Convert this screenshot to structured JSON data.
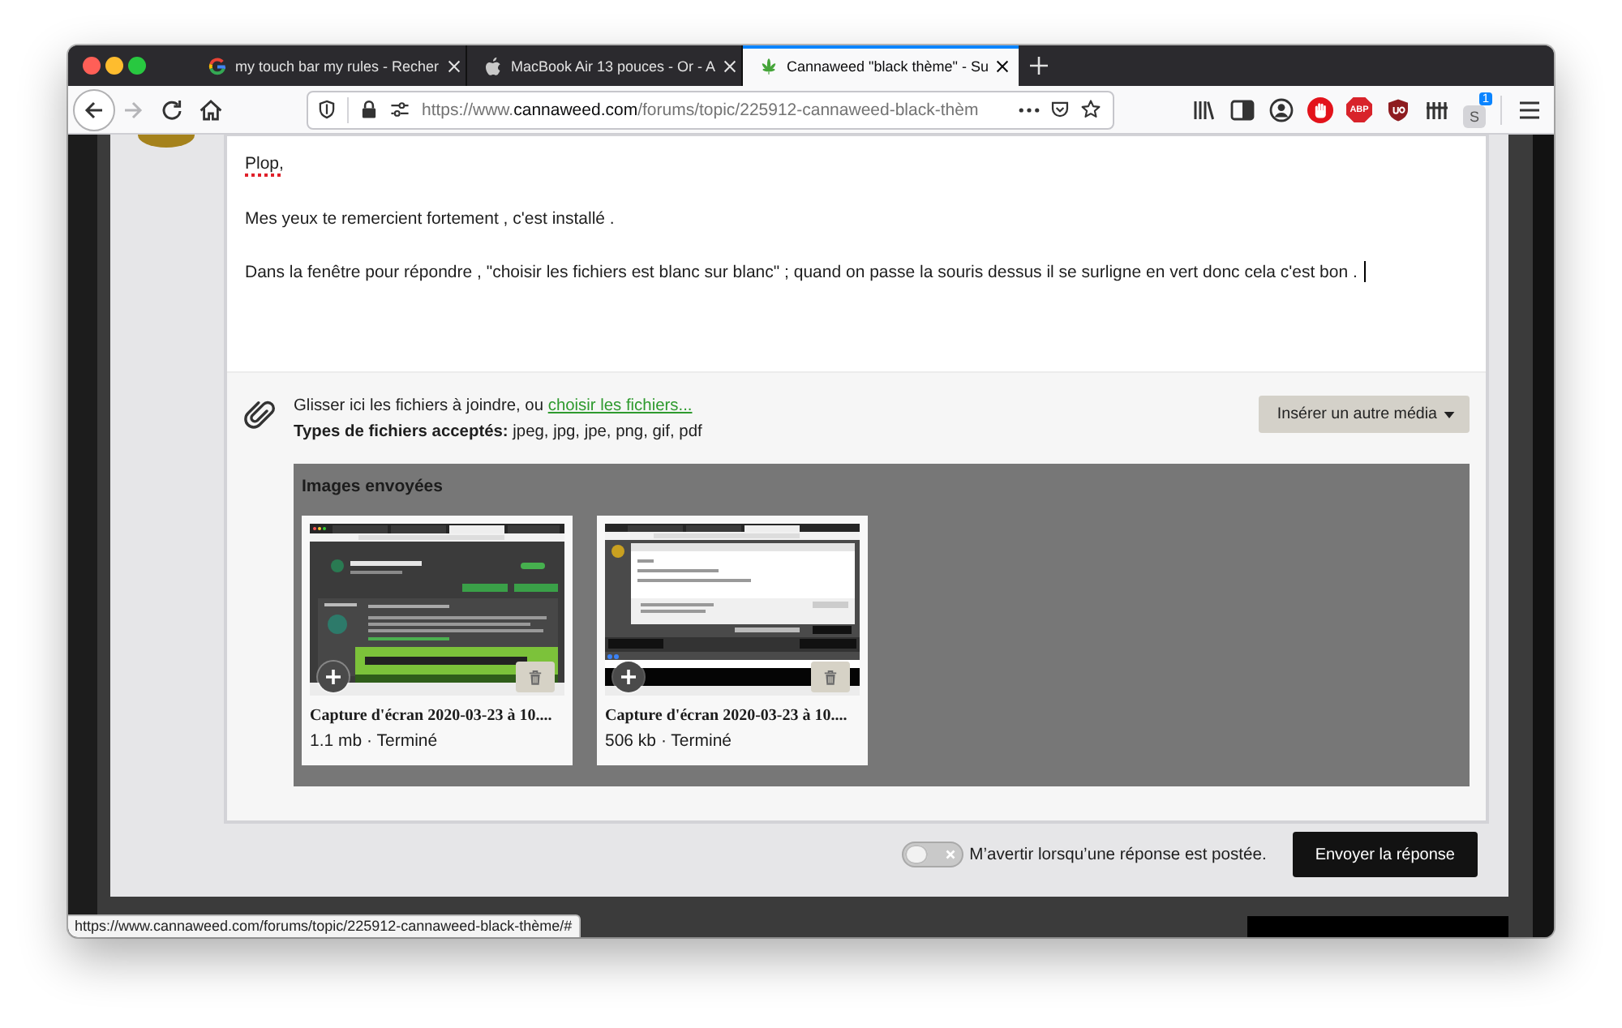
{
  "tabs": [
    {
      "kind": "google",
      "title": "my touch bar my rules - Recher",
      "selected": false
    },
    {
      "kind": "apple",
      "title": "MacBook Air 13 pouces - Or - A",
      "selected": false
    },
    {
      "kind": "leaf",
      "title": "Cannaweed \"black thème\" - Su",
      "selected": true
    }
  ],
  "toolbar": {
    "forward_disabled": true,
    "url": {
      "scheme": "https://www.",
      "domain": "cannaweed.com",
      "path": "/forums/topic/225912-cannaweed-black-thèm"
    },
    "extensions": [
      {
        "kind": "hand"
      },
      {
        "kind": "octagon",
        "label": "ABP"
      },
      {
        "kind": "shield"
      },
      {
        "kind": "bars"
      },
      {
        "kind": "tile",
        "label": "S",
        "badge": "1"
      }
    ]
  },
  "editor": {
    "paragraphs": [
      {
        "text": "Plop,",
        "spelling_error": true,
        "has_cursor": false
      },
      {
        "text": "Mes yeux te remercient fortement , c'est installé .",
        "spelling_error": false,
        "has_cursor": false
      },
      {
        "text": "Dans la fenêtre pour répondre , \"choisir les fichiers est blanc sur blanc\" ; quand on passe la souris dessus il se surligne en vert donc cela c'est bon .",
        "spelling_error": false,
        "has_cursor": true
      }
    ]
  },
  "attachments": {
    "prompt": "Glisser ici les fichiers à joindre, ou",
    "link": "choisir les fichiers...",
    "accepted": "**Types de fichiers acceptés:** jpeg, jpg, jpe, png, gif, pdf",
    "insert_button": "Insérer un autre média",
    "uploads": {
      "title": "Images envoyées",
      "items": [
        {
          "kind": "dark",
          "name": "Capture d'écran 2020-03-23 à 10....",
          "info": "1.1 mb · Terminé"
        },
        {
          "kind": "light",
          "name": "Capture d'écran 2020-03-23 à 10....",
          "info": "506 kb · Terminé"
        }
      ]
    }
  },
  "notify": {
    "label": "M’avertir lorsqu’une réponse est postée.",
    "on": false
  },
  "submit_button": "Envoyer la réponse",
  "status_url": "https://www.cannaweed.com/forums/topic/225912-cannaweed-black-thème/#"
}
